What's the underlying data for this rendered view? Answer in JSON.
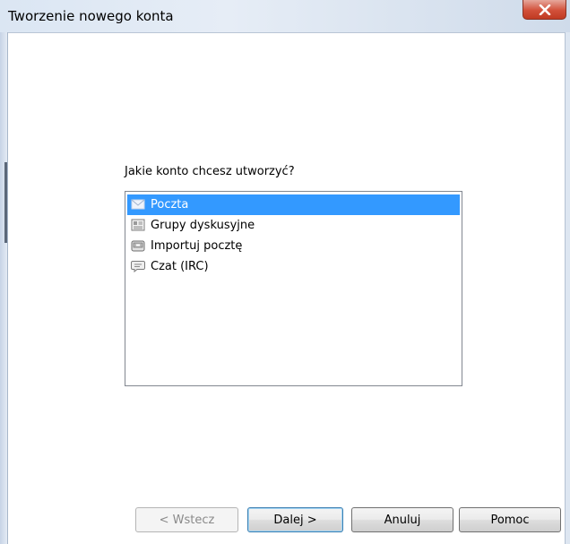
{
  "window": {
    "title": "Tworzenie nowego konta"
  },
  "main": {
    "prompt": "Jakie konto chcesz utworzyć?",
    "account_types": [
      {
        "label": "Poczta",
        "icon": "envelope-icon",
        "selected": true
      },
      {
        "label": "Grupy dyskusyjne",
        "icon": "newsgroup-icon",
        "selected": false
      },
      {
        "label": "Importuj pocztę",
        "icon": "import-icon",
        "selected": false
      },
      {
        "label": "Czat (IRC)",
        "icon": "chat-icon",
        "selected": false
      }
    ]
  },
  "buttons": {
    "back": "< Wstecz",
    "next": "Dalej >",
    "cancel": "Anuluj",
    "help": "Pomoc"
  },
  "colors": {
    "selection": "#3399ff",
    "close_button": "#c9462f"
  }
}
